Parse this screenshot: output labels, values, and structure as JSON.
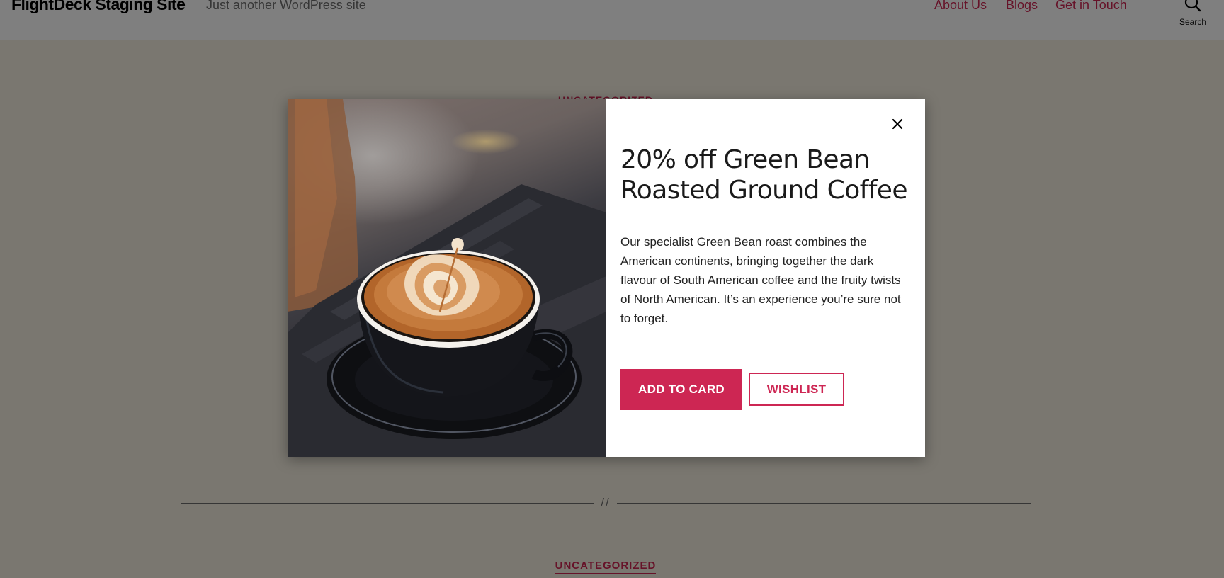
{
  "site": {
    "title": "FlightDeck Staging Site",
    "tagline": "Just another WordPress site"
  },
  "nav": {
    "items": [
      {
        "label": "About Us"
      },
      {
        "label": "Blogs"
      },
      {
        "label": "Get in Touch"
      }
    ],
    "search_label": "Search"
  },
  "content": {
    "top_category": "UNCATEGORIZED",
    "separator": "//",
    "bottom_category": "UNCATEGORIZED"
  },
  "popup": {
    "image_subject": "latte-art-coffee-cup",
    "title": "20% off Green Bean Roasted Ground Coffee",
    "description": "Our specialist Green Bean roast combines the American continents, bringing together the dark flavour of South American coffee and the fruity twists of North American. It’s an experience you’re sure not to forget.",
    "primary_button": "ADD TO CARD",
    "secondary_button": "WISHLIST",
    "close_icon": "close-icon"
  },
  "colors": {
    "accent": "#cd2653",
    "page_background": "#f5efe0",
    "overlay": "rgba(0,0,0,0.5)"
  }
}
